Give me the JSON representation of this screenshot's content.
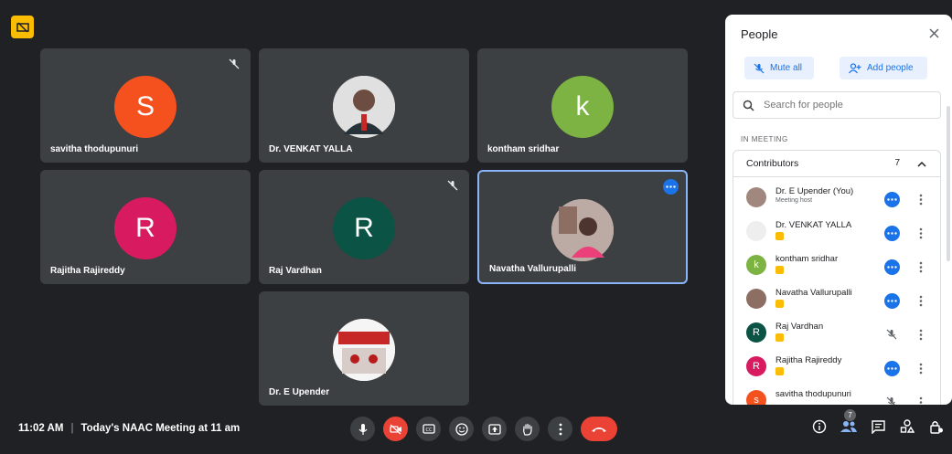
{
  "meeting": {
    "time": "11:02 AM",
    "separator": "|",
    "title": "Today's NAAC Meeting at 11 am"
  },
  "tiles": [
    {
      "name": "savitha thodupunuri",
      "initial": "S",
      "color": "#f4511e",
      "muted": true
    },
    {
      "name": "Dr. VENKAT YALLA",
      "initial": "",
      "color": "#ffffff",
      "photo": true
    },
    {
      "name": "kontham sridhar",
      "initial": "k",
      "color": "#7cb342"
    },
    {
      "name": "Rajitha Rajireddy",
      "initial": "R",
      "color": "#d81b60"
    },
    {
      "name": "Raj Vardhan",
      "initial": "R",
      "color": "#0b5345",
      "muted": true
    },
    {
      "name": "Navatha Vallurupalli",
      "initial": "",
      "color": "#cfd8dc",
      "photo": true,
      "active": true
    },
    {
      "name": "Dr. E Upender",
      "initial": "",
      "color": "#ffffff",
      "photo": true
    }
  ],
  "people": {
    "title": "People",
    "mute_all": "Mute all",
    "add_people": "Add people",
    "search_placeholder": "Search for people",
    "in_meeting": "IN MEETING",
    "contributors": "Contributors",
    "count": "7",
    "list": [
      {
        "name": "Dr. E Upender (You)",
        "sub": "Meeting host",
        "initial": "",
        "color": "#a1887f",
        "action": "dots"
      },
      {
        "name": "Dr. VENKAT YALLA",
        "sub": "",
        "initial": "",
        "color": "#ffffff",
        "action": "dots"
      },
      {
        "name": "kontham sridhar",
        "sub": "",
        "initial": "k",
        "color": "#7cb342",
        "action": "dots"
      },
      {
        "name": "Navatha Vallurupalli",
        "sub": "",
        "initial": "",
        "color": "#8d6e63",
        "action": "dots"
      },
      {
        "name": "Raj Vardhan",
        "sub": "",
        "initial": "R",
        "color": "#0b5345",
        "action": "muted"
      },
      {
        "name": "Rajitha Rajireddy",
        "sub": "",
        "initial": "R",
        "color": "#d81b60",
        "action": "dots"
      },
      {
        "name": "savitha thodupunuri",
        "sub": "",
        "initial": "s",
        "color": "#f4511e",
        "action": "muted"
      }
    ]
  },
  "toolbar": {
    "participants_count": "7",
    "icons": [
      "mic-icon",
      "camera-off-icon",
      "captions-icon",
      "emoji-icon",
      "present-icon",
      "raise-hand-icon",
      "more-options-icon",
      "hang-up-icon"
    ],
    "right_icons": [
      "info-icon",
      "people-icon",
      "chat-icon",
      "activities-icon",
      "host-controls-icon"
    ]
  },
  "colors": {
    "background": "#202124",
    "tile": "#3c4043",
    "accent": "#1a73e8",
    "danger": "#ea4335"
  }
}
